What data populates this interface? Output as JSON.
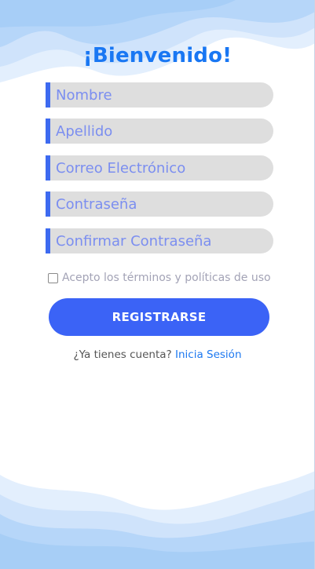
{
  "title": "¡Bienvenido!",
  "form": {
    "fields": [
      {
        "placeholder": "Nombre",
        "value": ""
      },
      {
        "placeholder": "Apellido",
        "value": ""
      },
      {
        "placeholder": "Correo Electrónico",
        "value": ""
      },
      {
        "placeholder": "Contraseña",
        "value": ""
      },
      {
        "placeholder": "Confirmar Contraseña",
        "value": ""
      }
    ],
    "terms_label": "Acepto los términos y políticas de uso",
    "terms_checked": false,
    "submit_label": "REGISTRARSE"
  },
  "login": {
    "prompt": "¿Ya tienes cuenta?",
    "link_label": "Inicia Sesión"
  },
  "colors": {
    "accent": "#3b63f6",
    "title": "#1977f3",
    "field_bg": "#dedede",
    "field_bar": "#3d6af0",
    "placeholder": "#7b8ef0",
    "link": "#1c78f0",
    "wave_light": "#cfe3fb",
    "wave_mid": "#a9cdf7"
  }
}
